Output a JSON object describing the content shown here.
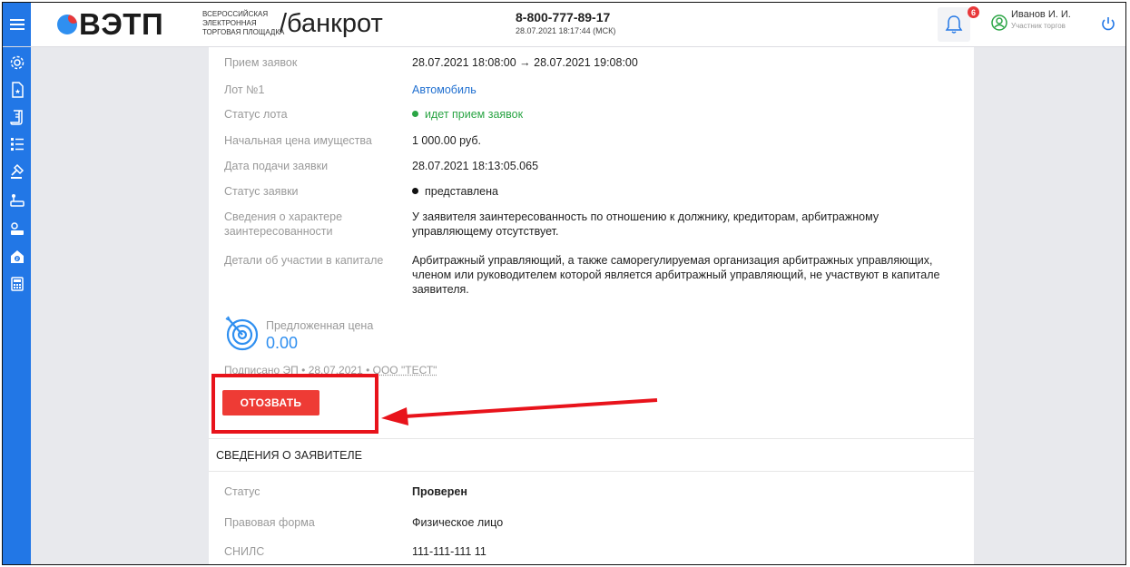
{
  "header": {
    "logo_text": "ВЭТП",
    "logo_sub": [
      "ВСЕРОССИЙСКАЯ",
      "ЭЛЕКТРОННАЯ",
      "ТОРГОВАЯ ПЛОЩАДКА"
    ],
    "brand_suffix": "/банкрот",
    "phone": "8-800-777-89-17",
    "datetime": "28.07.2021 18:17:44 (МСК)",
    "notifications_count": "6",
    "user_name": "Иванов И. И.",
    "user_role": "Участник торгов"
  },
  "sidebar": {
    "icons": [
      "settings-icon",
      "document-star-icon",
      "scroll-icon",
      "list-icon",
      "gavel-icon",
      "auction-icon",
      "auction-alt-icon",
      "bank-icon",
      "calculator-icon"
    ]
  },
  "application": {
    "rows": [
      {
        "label": "Прием заявок",
        "value": "28.07.2021 18:08:00 → 28.07.2021 19:08:00"
      },
      {
        "label": "Лот №1",
        "value": "Автомобиль"
      },
      {
        "label": "Статус лота",
        "value": "идет прием заявок"
      },
      {
        "label": "Начальная цена имущества",
        "value": "1 000.00 руб."
      },
      {
        "label": "Дата подачи заявки",
        "value": "28.07.2021 18:13:05.065"
      },
      {
        "label": "Статус заявки",
        "value": "представлена"
      },
      {
        "label": "Сведения о характере заинтересованности",
        "value": "У заявителя заинтересованность по отношению к должнику, кредиторам, арбитражному управляющему отсутствует."
      },
      {
        "label": "Детали об участии в капитале",
        "value": "Арбитражный управляющий, а также саморегулируемая организация арбитражных управляющих, членом или руководителем которой является арбитражный управляющий, не участвуют в капитале заявителя."
      }
    ],
    "offer_label": "Предложенная цена",
    "offer_value": "0.00",
    "signed": "Подписано ЭП",
    "signed_date": "28.07.2021",
    "signed_org": "ООО \"ТЕСТ\"",
    "separator": "•",
    "withdraw_button": "ОТОЗВАТЬ"
  },
  "applicant": {
    "section_title": "СВЕДЕНИЯ О ЗАЯВИТЕЛЕ",
    "rows": [
      {
        "label": "Статус",
        "value": "Проверен"
      },
      {
        "label": "Правовая форма",
        "value": "Физическое лицо"
      },
      {
        "label": "СНИЛС",
        "value": "111-111-111 11"
      }
    ]
  },
  "colors": {
    "sidebar": "#2277e6",
    "accent_red": "#ee3b35",
    "status_green": "#2ba545",
    "link_blue": "#1f6fd0"
  }
}
